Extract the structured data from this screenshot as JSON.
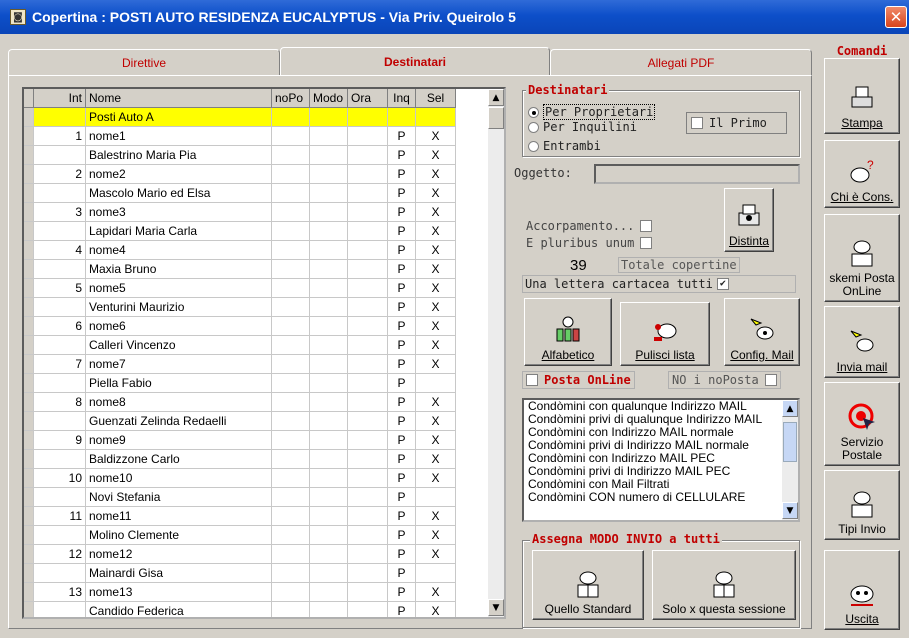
{
  "window": {
    "title": "Copertina : POSTI AUTO RESIDENZA EUCALYPTUS - Via Priv. Queirolo 5",
    "close_icon": "close-icon"
  },
  "tabs": [
    {
      "label": "Direttive",
      "active": false
    },
    {
      "label": "Destinatari",
      "active": true
    },
    {
      "label": "Allegati PDF",
      "active": false
    }
  ],
  "grid": {
    "columns": [
      "Int",
      "Nome",
      "noPo",
      "Modo",
      "Ora",
      "Inq",
      "Sel"
    ],
    "rows": [
      {
        "int": "",
        "nome": "Posti Auto A",
        "nopo": "",
        "modo": "",
        "ora": "",
        "inq": "",
        "sel": "",
        "highlight": true
      },
      {
        "int": "1",
        "nome": "nome1",
        "nopo": "",
        "modo": "",
        "ora": "",
        "inq": "P",
        "sel": "X"
      },
      {
        "int": "",
        "nome": "Balestrino Maria Pia",
        "nopo": "",
        "modo": "",
        "ora": "",
        "inq": "P",
        "sel": "X"
      },
      {
        "int": "2",
        "nome": "nome2",
        "nopo": "",
        "modo": "",
        "ora": "",
        "inq": "P",
        "sel": "X"
      },
      {
        "int": "",
        "nome": "Mascolo Mario ed Elsa",
        "nopo": "",
        "modo": "",
        "ora": "",
        "inq": "P",
        "sel": "X"
      },
      {
        "int": "3",
        "nome": "nome3",
        "nopo": "",
        "modo": "",
        "ora": "",
        "inq": "P",
        "sel": "X"
      },
      {
        "int": "",
        "nome": "Lapidari Maria Carla",
        "nopo": "",
        "modo": "",
        "ora": "",
        "inq": "P",
        "sel": "X"
      },
      {
        "int": "4",
        "nome": "nome4",
        "nopo": "",
        "modo": "",
        "ora": "",
        "inq": "P",
        "sel": "X"
      },
      {
        "int": "",
        "nome": "Maxia Bruno",
        "nopo": "",
        "modo": "",
        "ora": "",
        "inq": "P",
        "sel": "X"
      },
      {
        "int": "5",
        "nome": "nome5",
        "nopo": "",
        "modo": "",
        "ora": "",
        "inq": "P",
        "sel": "X"
      },
      {
        "int": "",
        "nome": "Venturini Maurizio",
        "nopo": "",
        "modo": "",
        "ora": "",
        "inq": "P",
        "sel": "X"
      },
      {
        "int": "6",
        "nome": "nome6",
        "nopo": "",
        "modo": "",
        "ora": "",
        "inq": "P",
        "sel": "X"
      },
      {
        "int": "",
        "nome": "Calleri Vincenzo",
        "nopo": "",
        "modo": "",
        "ora": "",
        "inq": "P",
        "sel": "X"
      },
      {
        "int": "7",
        "nome": "nome7",
        "nopo": "",
        "modo": "",
        "ora": "",
        "inq": "P",
        "sel": "X"
      },
      {
        "int": "",
        "nome": "Piella Fabio",
        "nopo": "",
        "modo": "",
        "ora": "",
        "inq": "P",
        "sel": ""
      },
      {
        "int": "8",
        "nome": "nome8",
        "nopo": "",
        "modo": "",
        "ora": "",
        "inq": "P",
        "sel": "X"
      },
      {
        "int": "",
        "nome": "Guenzati Zelinda Redaelli",
        "nopo": "",
        "modo": "",
        "ora": "",
        "inq": "P",
        "sel": "X"
      },
      {
        "int": "9",
        "nome": "nome9",
        "nopo": "",
        "modo": "",
        "ora": "",
        "inq": "P",
        "sel": "X"
      },
      {
        "int": "",
        "nome": "Baldizzone Carlo",
        "nopo": "",
        "modo": "",
        "ora": "",
        "inq": "P",
        "sel": "X"
      },
      {
        "int": "10",
        "nome": "nome10",
        "nopo": "",
        "modo": "",
        "ora": "",
        "inq": "P",
        "sel": "X"
      },
      {
        "int": "",
        "nome": "Novi Stefania",
        "nopo": "",
        "modo": "",
        "ora": "",
        "inq": "P",
        "sel": ""
      },
      {
        "int": "11",
        "nome": "nome11",
        "nopo": "",
        "modo": "",
        "ora": "",
        "inq": "P",
        "sel": "X"
      },
      {
        "int": "",
        "nome": "Molino Clemente",
        "nopo": "",
        "modo": "",
        "ora": "",
        "inq": "P",
        "sel": "X"
      },
      {
        "int": "12",
        "nome": "nome12",
        "nopo": "",
        "modo": "",
        "ora": "",
        "inq": "P",
        "sel": "X"
      },
      {
        "int": "",
        "nome": "Mainardi Gisa",
        "nopo": "",
        "modo": "",
        "ora": "",
        "inq": "P",
        "sel": ""
      },
      {
        "int": "13",
        "nome": "nome13",
        "nopo": "",
        "modo": "",
        "ora": "",
        "inq": "P",
        "sel": "X"
      },
      {
        "int": "",
        "nome": "Candido Federica",
        "nopo": "",
        "modo": "",
        "ora": "",
        "inq": "P",
        "sel": "X"
      }
    ]
  },
  "destinatari": {
    "title": "Destinatari",
    "options": [
      {
        "label": "Per Proprietari",
        "selected": true
      },
      {
        "label": "Per Inquilini",
        "selected": false
      },
      {
        "label": "Entrambi",
        "selected": false
      }
    ],
    "il_primo_label": "Il Primo",
    "il_primo_checked": false
  },
  "oggetto": {
    "label": "Oggetto:",
    "value": ""
  },
  "accorpamento": {
    "label": "Accorpamento...",
    "checked": false
  },
  "e_pluribus": {
    "label": "E pluribus unum",
    "checked": false
  },
  "distinta_label": "Distinta",
  "totale": {
    "count": "39",
    "label": "Totale copertine"
  },
  "lettera": {
    "label": "Una lettera cartacea tutti",
    "checked": true,
    "check_mark": "✔"
  },
  "actions": {
    "alfabetico": "Alfabetico",
    "pulisci": "Pulisci lista",
    "config_mail": "Config. Mail"
  },
  "posta_online": {
    "label": "Posta OnLine",
    "checked": false,
    "no_label": "NO i noPosta",
    "no_checked": false
  },
  "filter_list": [
    "Condòmini con qualunque Indirizzo MAIL",
    "Condòmini privi di qualunque Indirizzo MAIL",
    "Condòmini con Indirizzo MAIL normale",
    "Condòmini privi di Indirizzo MAIL normale",
    "Condòmini con Indirizzo MAIL PEC",
    "Condòmini privi di Indirizzo MAIL PEC",
    "Condòmini con Mail Filtrati",
    "Condòmini CON numero di CELLULARE"
  ],
  "assegna": {
    "title": "Assegna MODO INVIO a tutti",
    "standard": "Quello Standard",
    "sessione": "Solo x questa sessione"
  },
  "comandi": {
    "title": "Comandi",
    "buttons": [
      "Stampa",
      "Chi è Cons.",
      "skemi Posta OnLine",
      "Invia mail",
      "Servizio Postale",
      "Tipi Invio",
      "Uscita"
    ]
  },
  "colors": {
    "titlebar": "#0d4fc9",
    "accent_red": "#c00000",
    "highlight": "#ffff00",
    "face": "#d4d0c8"
  }
}
